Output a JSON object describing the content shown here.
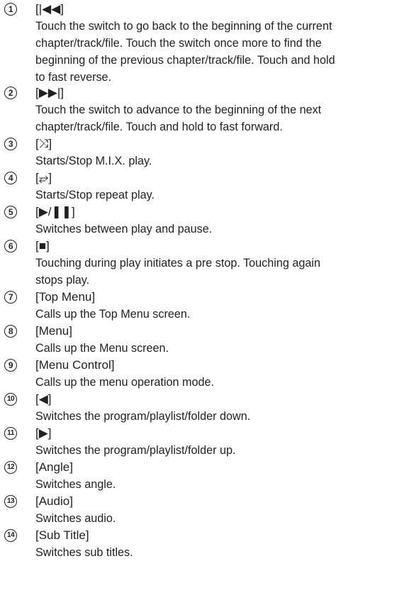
{
  "items": [
    {
      "num": "1",
      "label": "[|◀◀]",
      "lines": [
        "Touch the switch to go back to the beginning of the current",
        "chapter/track/file. Touch the switch once more to find the",
        "beginning of the previous chapter/track/file. Touch and hold",
        "to fast reverse."
      ]
    },
    {
      "num": "2",
      "label": "[▶▶|]",
      "lines": [
        "Touch the switch to advance to the beginning of the next",
        "chapter/track/file. Touch and hold to fast forward."
      ]
    },
    {
      "num": "3",
      "label": "[⤨]",
      "lines": [
        "Starts/Stop M.I.X. play."
      ]
    },
    {
      "num": "4",
      "label": "[⥂]",
      "lines": [
        "Starts/Stop repeat play."
      ]
    },
    {
      "num": "5",
      "label": "[▶/❚❚]",
      "lines": [
        "Switches between play and pause."
      ]
    },
    {
      "num": "6",
      "label": "[■]",
      "lines": [
        "Touching during play initiates a pre stop. Touching again",
        "stops play."
      ]
    },
    {
      "num": "7",
      "label": "[Top Menu]",
      "lines": [
        "Calls up the Top Menu screen."
      ]
    },
    {
      "num": "8",
      "label": "[Menu]",
      "lines": [
        "Calls up the Menu screen."
      ]
    },
    {
      "num": "9",
      "label": "[Menu Control]",
      "lines": [
        "Calls up the menu operation mode."
      ]
    },
    {
      "num": "10",
      "label": "[◀]",
      "lines": [
        "Switches the program/playlist/folder down."
      ]
    },
    {
      "num": "11",
      "label": "[▶]",
      "lines": [
        "Switches the program/playlist/folder up."
      ]
    },
    {
      "num": "12",
      "label": "[Angle]",
      "lines": [
        "Switches angle."
      ]
    },
    {
      "num": "13",
      "label": "[Audio]",
      "lines": [
        "Switches audio."
      ]
    },
    {
      "num": "14",
      "label": "[Sub Title]",
      "lines": [
        "Switches sub titles."
      ]
    }
  ]
}
